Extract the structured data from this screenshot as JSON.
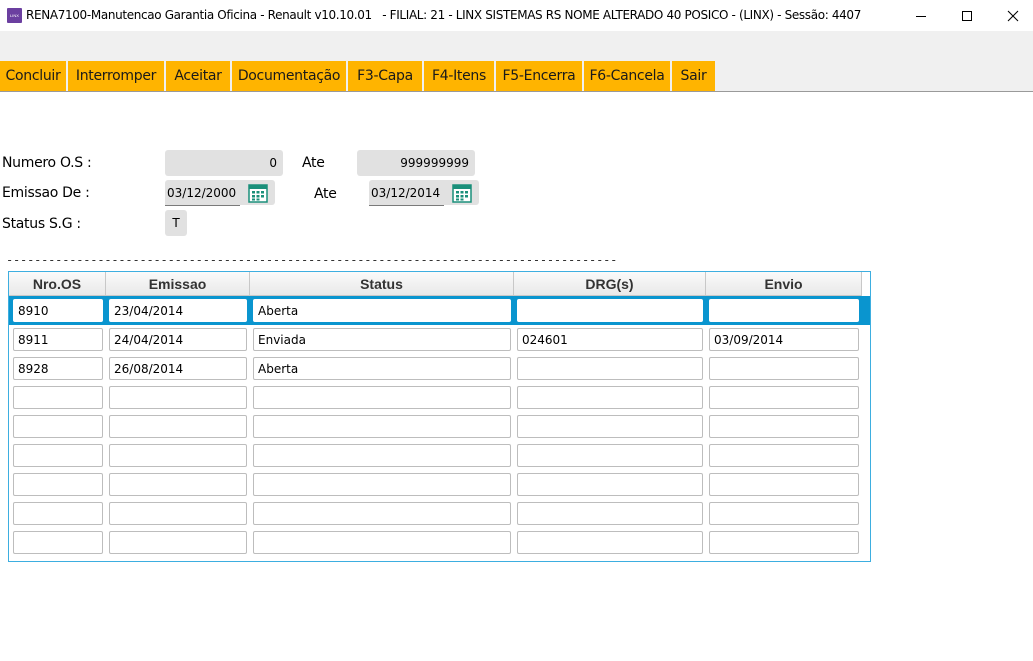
{
  "window": {
    "title": "RENA7100-Manutencao Garantia Oficina - Renault v10.10.01   - FILIAL: 21 - LINX SISTEMAS RS NOME ALTERADO 40 POSICO - (LINX) - Sessão: 4407",
    "icon_text": "LINX",
    "controls": [
      "minimize-icon",
      "maximize-icon",
      "close-icon"
    ]
  },
  "toolbar": {
    "buttons": [
      "Concluir",
      "Interromper",
      "Aceitar",
      "Documentação",
      "F3-Capa",
      "F4-Itens",
      "F5-Encerra",
      "F6-Cancela",
      "Sair"
    ],
    "color": "#ffb400"
  },
  "filters": {
    "numero_os_label": "Numero O.S :",
    "numero_os_from": "0",
    "ate_label": "Ate",
    "numero_os_to": "999999999",
    "emissao_label": "Emissao De :",
    "emissao_from": "03/12/2000",
    "emissao_ate_label": "Ate",
    "emissao_to": "03/12/2014",
    "status_label": "Status S.G :",
    "status_value": "T",
    "calendar_icon": "calendar-icon"
  },
  "separator": "---------------------------------------------------------------------------------------",
  "grid": {
    "columns": [
      "Nro.OS",
      "Emissao",
      "Status",
      "DRG(s)",
      "Envio"
    ],
    "selected_row": 0,
    "accent": "#0a95cf",
    "rows": [
      [
        "8910",
        "23/04/2014",
        "Aberta",
        "",
        ""
      ],
      [
        "8911",
        "24/04/2014",
        "Enviada",
        "024601",
        "03/09/2014"
      ],
      [
        "8928",
        "26/08/2014",
        "Aberta",
        "",
        ""
      ],
      [
        "",
        "",
        "",
        "",
        ""
      ],
      [
        "",
        "",
        "",
        "",
        ""
      ],
      [
        "",
        "",
        "",
        "",
        ""
      ],
      [
        "",
        "",
        "",
        "",
        ""
      ],
      [
        "",
        "",
        "",
        "",
        ""
      ],
      [
        "",
        "",
        "",
        "",
        ""
      ]
    ]
  }
}
